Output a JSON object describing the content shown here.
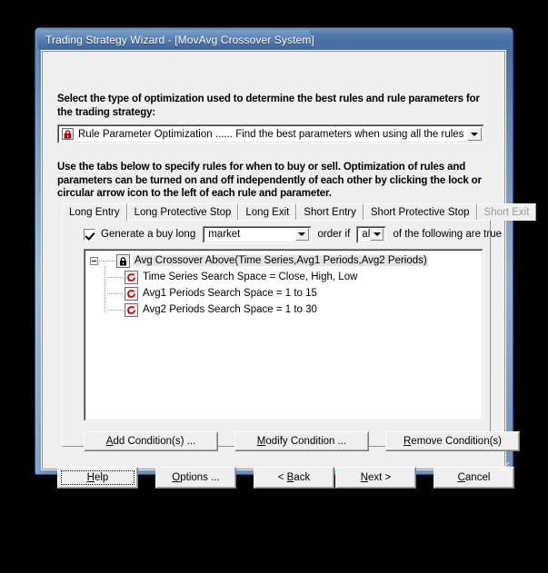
{
  "window": {
    "title": "Trading Strategy Wizard - [MovAvg Crossover System]"
  },
  "instructions": {
    "line1": "Select the type of optimization used to determine the best rules and rule parameters for the trading strategy:",
    "line2": "Use the tabs below to specify rules for when to buy or sell.  Optimization of rules and parameters can be turned on and off independently of each other by clicking the lock or circular arrow icon to the left of each rule and parameter."
  },
  "optimization_combo": {
    "icon": "lock-icon",
    "value": "Rule Parameter Optimization ...... Find the best parameters when using all the rules",
    "arrow_icon": "chevron-down-icon"
  },
  "tabs": [
    {
      "label": "Long Entry",
      "selected": true,
      "disabled": false
    },
    {
      "label": "Long Protective Stop",
      "selected": false,
      "disabled": false
    },
    {
      "label": "Long Exit",
      "selected": false,
      "disabled": false
    },
    {
      "label": "Short Entry",
      "selected": false,
      "disabled": false
    },
    {
      "label": "Short Protective Stop",
      "selected": false,
      "disabled": false
    },
    {
      "label": "Short Exit",
      "selected": false,
      "disabled": true
    }
  ],
  "rule_row": {
    "checkbox_checked": true,
    "label_before": "Generate a buy long",
    "order_type": "market",
    "label_middle": "order if",
    "quantifier": "all",
    "label_after": "of the following are true"
  },
  "tree": {
    "root": {
      "icon": "lock-icon",
      "expander": "collapse-icon",
      "label": "Avg Crossover Above(Time Series,Avg1 Periods,Avg2 Periods)"
    },
    "children": [
      {
        "icon": "circular-arrow-icon",
        "label": "Time Series Search Space = Close, High, Low"
      },
      {
        "icon": "circular-arrow-icon",
        "label": "Avg1 Periods Search Space = 1 to 15"
      },
      {
        "icon": "circular-arrow-icon",
        "label": "Avg2 Periods Search Space = 1 to 30"
      }
    ]
  },
  "condition_buttons": {
    "add": {
      "accel": "A",
      "rest": "dd Condition(s) ..."
    },
    "modify": {
      "accel": "M",
      "rest": "odify Condition ..."
    },
    "remove": {
      "accel": "R",
      "rest": "emove Condition(s)"
    }
  },
  "dialog_buttons": {
    "help": {
      "pre": "",
      "accel": "H",
      "rest": "elp",
      "focused": true
    },
    "options": {
      "pre": "",
      "accel": "O",
      "rest": "ptions ...",
      "focused": false
    },
    "back": {
      "pre": "< ",
      "accel": "B",
      "rest": "ack",
      "focused": false
    },
    "next": {
      "pre": "",
      "accel": "N",
      "rest": "ext >",
      "focused": false
    },
    "cancel": {
      "pre": "",
      "accel": "C",
      "rest": "ancel",
      "focused": false
    }
  },
  "colors": {
    "title_gradient_start": "#7ba0c8",
    "title_gradient_end": "#3e6699",
    "dialog_face": "#efefef",
    "field_bg": "#ffffff",
    "lock_red": "#cc0000",
    "disabled_text": "#9a9a9a"
  }
}
